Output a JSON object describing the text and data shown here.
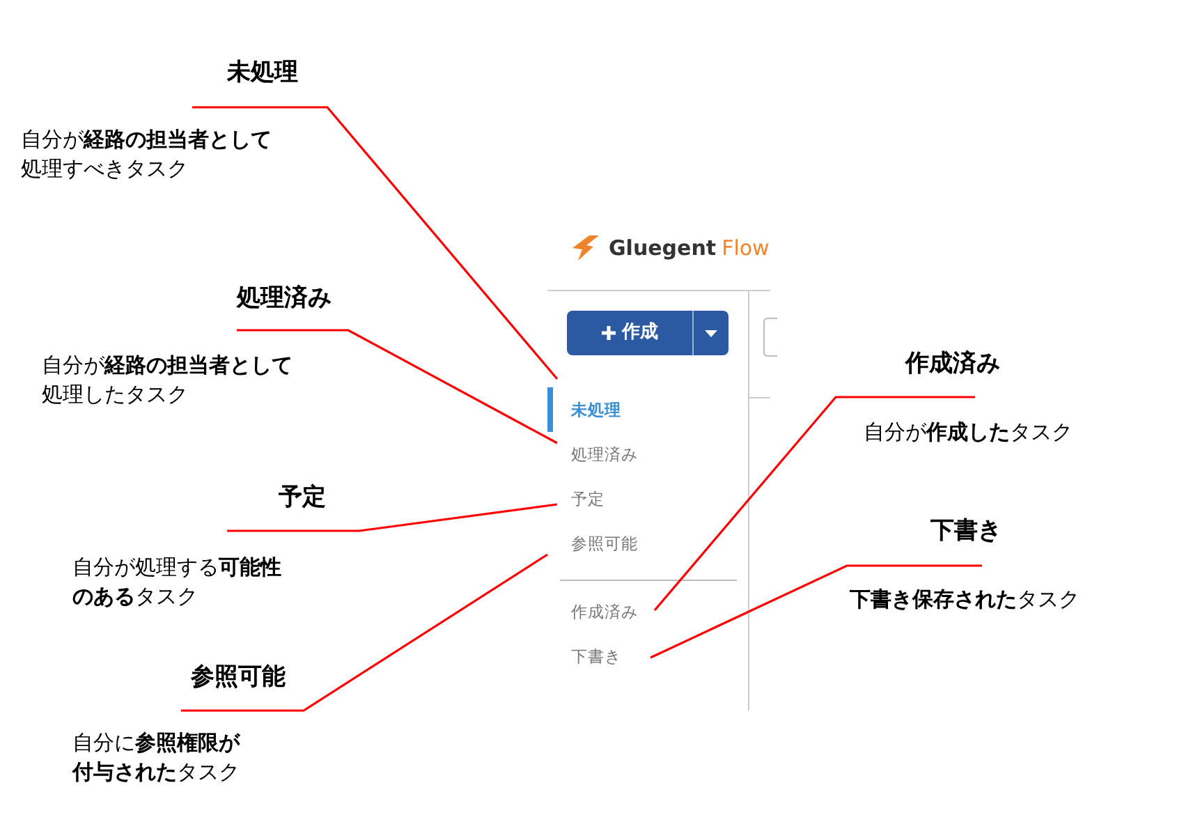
{
  "app": {
    "brand": "Gluegent",
    "product": "Flow"
  },
  "create_button": {
    "label": "作成"
  },
  "nav_groups": [
    [
      {
        "label": "未処理",
        "selected": true
      },
      {
        "label": "処理済み",
        "selected": false
      },
      {
        "label": "予定",
        "selected": false
      },
      {
        "label": "参照可能",
        "selected": false
      }
    ],
    [
      {
        "label": "作成済み",
        "selected": false
      },
      {
        "label": "下書き",
        "selected": false
      }
    ]
  ],
  "callouts": [
    {
      "title": "未処理",
      "lines": [
        "自分が**経路の担当者として**",
        "処理すべきタスク"
      ]
    },
    {
      "title": "処理済み",
      "lines": [
        "自分が**経路の担当者として**",
        "処理したタスク"
      ]
    },
    {
      "title": "予定",
      "lines": [
        "自分が処理する**可能性**",
        "**のある**タスク"
      ]
    },
    {
      "title": "参照可能",
      "lines": [
        "自分に**参照権限が**",
        "**付与された**タスク"
      ]
    },
    {
      "title": "作成済み",
      "lines": [
        "自分が**作成した**タスク"
      ]
    },
    {
      "title": "下書き",
      "lines": [
        "**下書き保存された**タスク"
      ]
    }
  ]
}
